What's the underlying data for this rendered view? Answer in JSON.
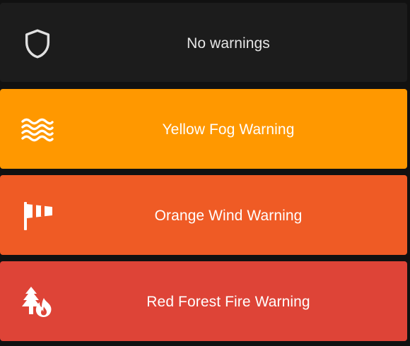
{
  "colors": {
    "page_background": "#111111",
    "none_card": "#1c1c1c",
    "yellow": "#ff9800",
    "orange": "#ef5b25",
    "red": "#de4437",
    "none_text": "#e6e6e6",
    "text": "#ffffff"
  },
  "cards": [
    {
      "icon": "shield-outline-icon",
      "label": "No warnings"
    },
    {
      "icon": "fog-waves-icon",
      "label": "Yellow Fog Warning"
    },
    {
      "icon": "windsock-icon",
      "label": "Orange Wind Warning"
    },
    {
      "icon": "forest-fire-icon",
      "label": "Red Forest Fire Warning"
    }
  ]
}
